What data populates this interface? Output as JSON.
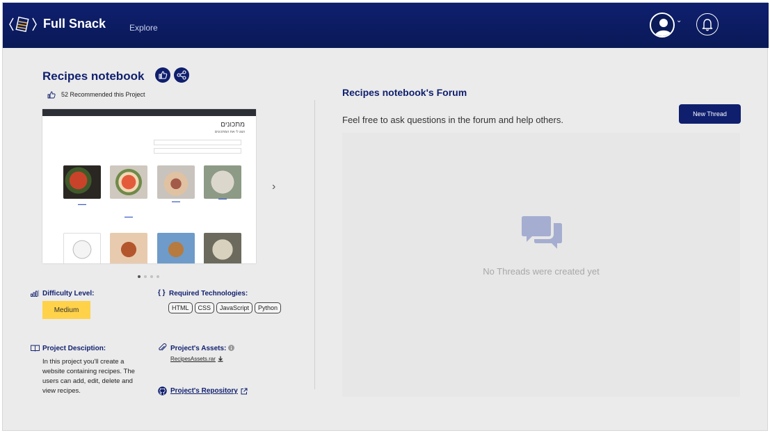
{
  "header": {
    "brand": "Full Snack",
    "nav": [
      {
        "label": "Explore"
      }
    ]
  },
  "project": {
    "title": "Recipes notebook",
    "recommend_text": "52 Recommended this Project",
    "carousel": {
      "slide_title": "מתכונים",
      "slide_subtitle": "הצג לי את המתכונים",
      "slide_count": 4,
      "active_slide": 1
    },
    "difficulty": {
      "label": "Difficulty Level:",
      "value": "Medium",
      "color": "#ffd24a"
    },
    "technologies": {
      "label": "Required Technologies:",
      "items": [
        "HTML",
        "CSS",
        "JavaScript",
        "Python"
      ]
    },
    "description": {
      "label": "Project Desciption:",
      "text": "In this project you'll create a website containing recipes. The users can add, edit, delete and view recipes."
    },
    "assets": {
      "label": "Project's Assets:",
      "file": "RecipesAssets.rar"
    },
    "repository": {
      "label": "Project's Repository"
    }
  },
  "forum": {
    "title": "Recipes notebook's Forum",
    "subtitle": "Feel free to ask questions in the forum and help others.",
    "new_thread_label": "New  Thread",
    "empty_text": "No Threads were created yet"
  },
  "colors": {
    "brand": "#0f1f6e",
    "background": "#ebebeb",
    "accent": "#ffd24a"
  }
}
